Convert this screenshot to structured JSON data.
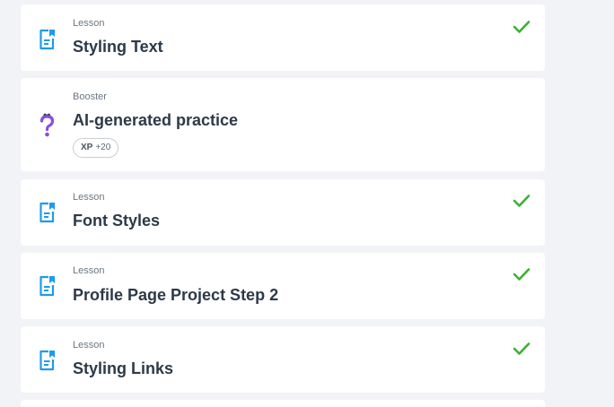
{
  "items": [
    {
      "type": "Lesson",
      "title": "Styling Text",
      "icon": "lesson-doc-icon",
      "completed": true
    },
    {
      "type": "Booster",
      "title": "AI-generated practice",
      "icon": "question-mark-icon",
      "completed": false,
      "xp_label": "XP",
      "xp_value": "+20"
    },
    {
      "type": "Lesson",
      "title": "Font Styles",
      "icon": "lesson-doc-icon",
      "completed": true
    },
    {
      "type": "Lesson",
      "title": "Profile Page Project Step 2",
      "icon": "lesson-doc-icon",
      "completed": true
    },
    {
      "type": "Lesson",
      "title": "Styling Links",
      "icon": "lesson-doc-icon",
      "completed": true
    }
  ],
  "colors": {
    "lesson_icon": "#1e9be9",
    "booster_icon": "#8a4de0",
    "check": "#3cb035",
    "card_bg": "#ffffff",
    "page_bg": "#f1f3f6",
    "title_text": "#2c3a48"
  }
}
